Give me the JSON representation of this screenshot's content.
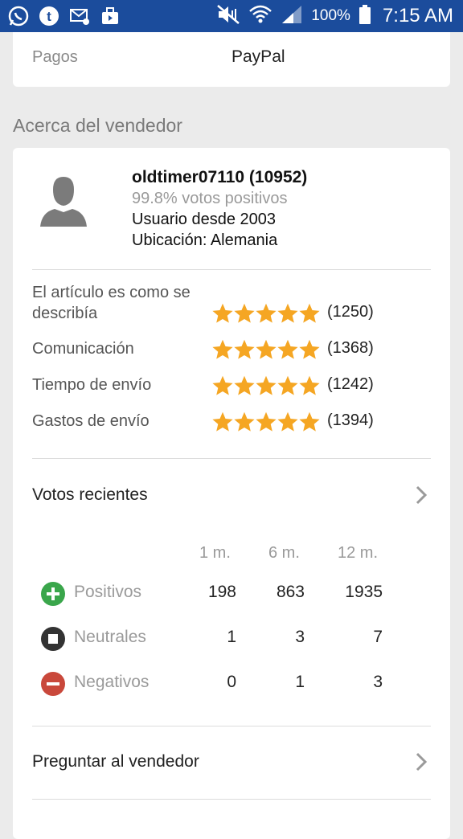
{
  "status_bar": {
    "battery": "100%",
    "time": "7:15 AM",
    "icons": [
      "whatsapp-icon",
      "tumblr-icon",
      "email-icon",
      "briefcase-icon",
      "mute-icon",
      "wifi-icon",
      "signal-icon",
      "battery-icon"
    ]
  },
  "payment": {
    "label": "Pagos",
    "value": "PayPal"
  },
  "seller_section": {
    "title": "Acerca del vendedor",
    "name": "oldtimer07110 (10952)",
    "positive": "99.8% votos positivos",
    "since": "Usuario desde 2003",
    "location": "Ubicación: Alemania"
  },
  "ratings": [
    {
      "label": "El artículo es como se describía",
      "stars": 5,
      "count": "(1250)"
    },
    {
      "label": "Comunicación",
      "stars": 5,
      "count": "(1368)"
    },
    {
      "label": "Tiempo de envío",
      "stars": 5,
      "count": "(1242)"
    },
    {
      "label": "Gastos de envío",
      "stars": 5,
      "count": "(1394)"
    }
  ],
  "recent_votes": {
    "title": "Votos recientes",
    "columns": [
      "1 m.",
      "6 m.",
      "12 m."
    ],
    "rows": [
      {
        "label": "Positivos",
        "values": [
          "198",
          "863",
          "1935"
        ]
      },
      {
        "label": "Neutrales",
        "values": [
          "1",
          "3",
          "7"
        ]
      },
      {
        "label": "Negativos",
        "values": [
          "0",
          "1",
          "3"
        ]
      }
    ]
  },
  "ask_seller": "Preguntar al vendedor",
  "colors": {
    "status_bar": "#1b4c9c",
    "star": "#f5a623",
    "positive": "#3aa64b",
    "neutral": "#333333",
    "negative": "#c9483b"
  }
}
